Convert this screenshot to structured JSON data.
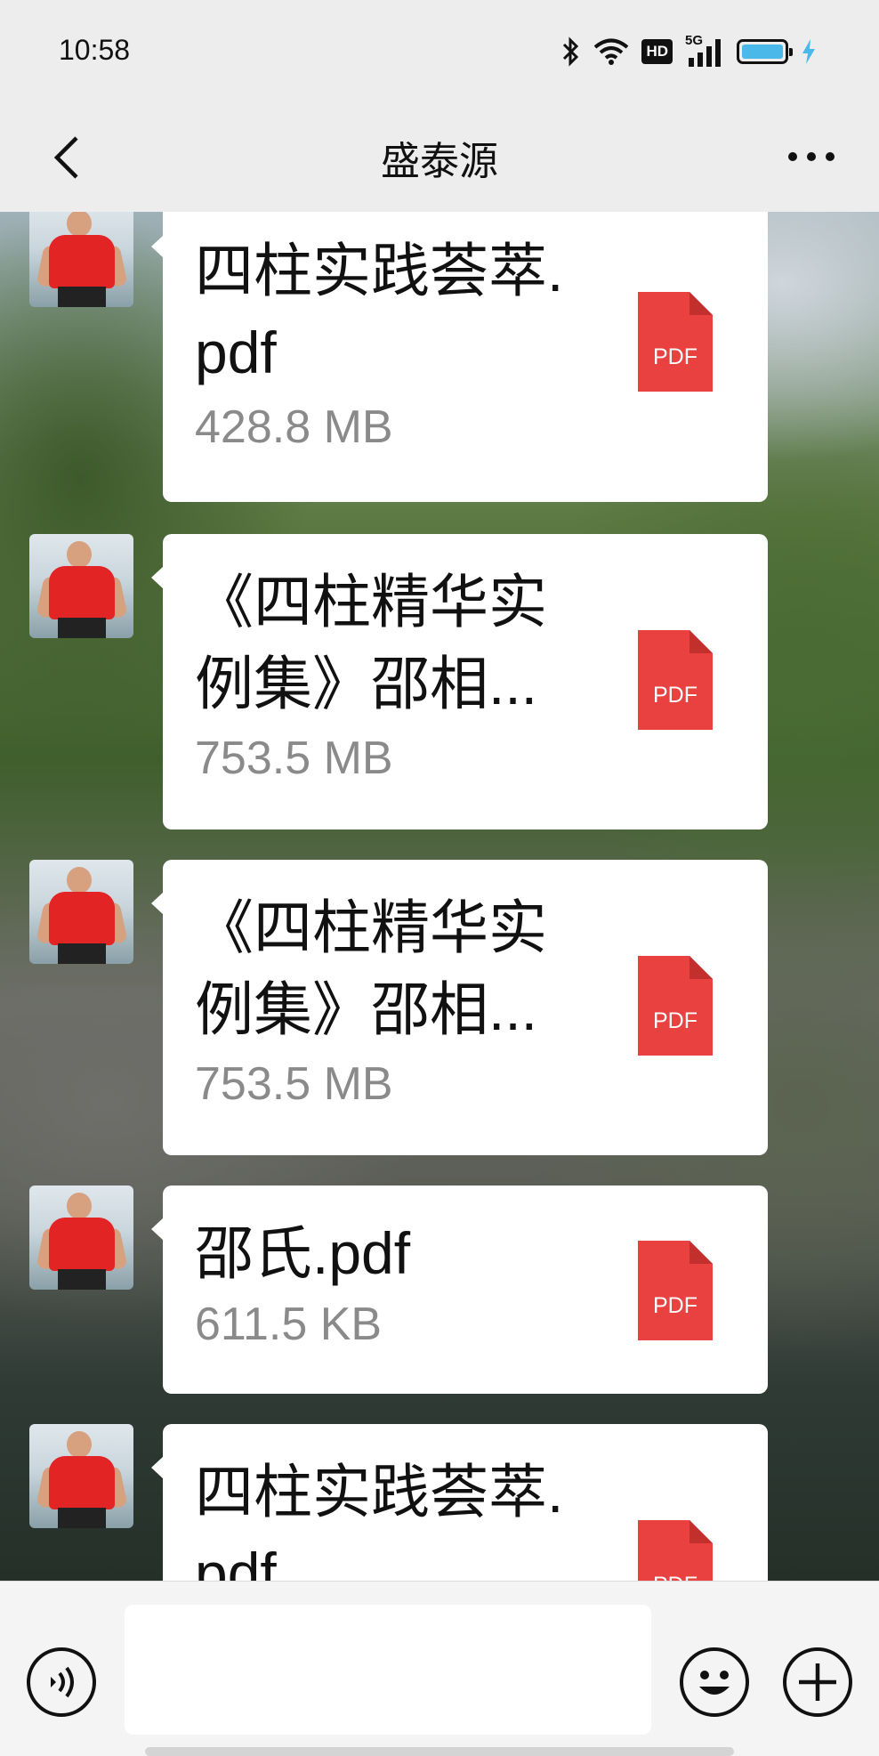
{
  "status_bar": {
    "time": "10:58",
    "icons": [
      "bluetooth-icon",
      "wifi-icon",
      "hd-icon",
      "5g-signal-icon",
      "battery-icon",
      "charging-icon"
    ],
    "hd_label": "HD",
    "network_label": "5G"
  },
  "nav": {
    "title": "盛泰源",
    "back_icon": "chevron-left-icon",
    "more_icon": "more-dots-icon"
  },
  "messages": [
    {
      "file_name": "四柱实践荟萃.pdf",
      "file_size": "428.8 MB",
      "icon_label": "PDF"
    },
    {
      "file_name": "《四柱精华实例集》邵相...",
      "file_size": "753.5 MB",
      "icon_label": "PDF"
    },
    {
      "file_name": "《四柱精华实例集》邵相...",
      "file_size": "753.5 MB",
      "icon_label": "PDF"
    },
    {
      "file_name": "邵氏.pdf",
      "file_size": "611.5 KB",
      "icon_label": "PDF"
    },
    {
      "file_name": "四柱实践荟萃.pdf",
      "file_size": "",
      "icon_label": "PDF"
    }
  ],
  "bottom_bar": {
    "voice_icon": "voice-icon",
    "input_value": "",
    "emoji_icon": "emoji-icon",
    "plus_icon": "plus-icon"
  },
  "colors": {
    "pdf_red": "#e8413f",
    "pdf_fold": "#c22f2d",
    "background_bar": "#ededed"
  }
}
